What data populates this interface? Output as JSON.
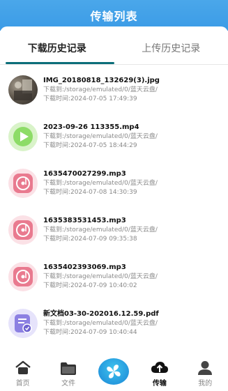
{
  "header": {
    "title": "传输列表"
  },
  "tabs": [
    {
      "label": "下载历史记录",
      "active": true
    },
    {
      "label": "上传历史记录",
      "active": false
    }
  ],
  "items": [
    {
      "icon": "photo-thumbnail",
      "name": "IMG_20180818_132629(3).jpg",
      "path": "下载到:/storage/emulated/0/蓝天云盘/",
      "time": "下载时间:2024-07-05 17:49:39"
    },
    {
      "icon": "video-play-icon",
      "name": "2023-09-26 113355.mp4",
      "path": "下载到:/storage/emulated/0/蓝天云盘/",
      "time": "下载时间:2024-07-05 18:44:29"
    },
    {
      "icon": "music-disc-icon",
      "name": "1635470027299.mp3",
      "path": "下载到:/storage/emulated/0/蓝天云盘/",
      "time": "下载时间:2024-07-08 14:30:39"
    },
    {
      "icon": "music-disc-icon",
      "name": "1635383531453.mp3",
      "path": "下载到:/storage/emulated/0/蓝天云盘/",
      "time": "下载时间:2024-07-09 09:35:38"
    },
    {
      "icon": "music-disc-icon",
      "name": "1635402393069.mp3",
      "path": "下载到:/storage/emulated/0/蓝天云盘/",
      "time": "下载时间:2024-07-09 10:40:02"
    },
    {
      "icon": "document-icon",
      "name": "新文档03-30-202016.12.59.pdf",
      "path": "下载到:/storage/emulated/0/蓝天云盘/",
      "time": "下载时间:2024-07-09 10:40:44"
    }
  ],
  "nav": [
    {
      "label": "首页",
      "icon": "home-icon",
      "active": false
    },
    {
      "label": "文件",
      "icon": "folder-icon",
      "active": false
    },
    {
      "label": "",
      "icon": "app-logo-icon",
      "active": false
    },
    {
      "label": "传输",
      "icon": "cloud-transfer-icon",
      "active": true
    },
    {
      "label": "我的",
      "icon": "user-icon",
      "active": false
    }
  ],
  "colors": {
    "header_blue": "#3b9be6",
    "tab_underline": "#0b6e79",
    "video_icon": "#7fd15c",
    "music_icon": "#e7768c",
    "pdf_icon": "#8a7fe0"
  }
}
